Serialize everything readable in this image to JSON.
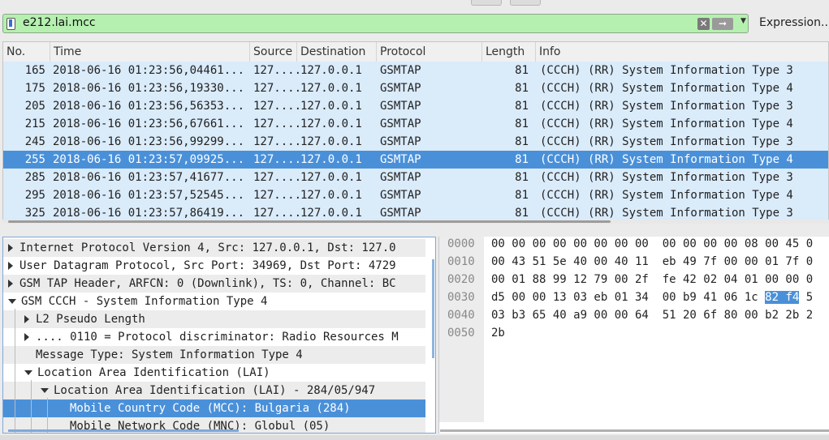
{
  "filter": {
    "value": "e212.lai.mcc",
    "clear_icon": "clear-icon",
    "apply_icon": "apply-arrow-icon",
    "dropdown_icon": "chevron-down-icon",
    "background": "#b6f0b0"
  },
  "expression_label": "Expression...",
  "packet_list": {
    "columns": [
      "No.",
      "Time",
      "Source",
      "Destination",
      "Protocol",
      "Length",
      "Info"
    ],
    "rows": [
      {
        "no": "165",
        "time": "2018-06-16 01:23:56,04461...",
        "source": "127....",
        "destination": "127.0.0.1",
        "protocol": "GSMTAP",
        "length": "81",
        "info": "(CCCH) (RR) System Information Type 3"
      },
      {
        "no": "175",
        "time": "2018-06-16 01:23:56,19330...",
        "source": "127....",
        "destination": "127.0.0.1",
        "protocol": "GSMTAP",
        "length": "81",
        "info": "(CCCH) (RR) System Information Type 4"
      },
      {
        "no": "205",
        "time": "2018-06-16 01:23:56,56353...",
        "source": "127....",
        "destination": "127.0.0.1",
        "protocol": "GSMTAP",
        "length": "81",
        "info": "(CCCH) (RR) System Information Type 3"
      },
      {
        "no": "215",
        "time": "2018-06-16 01:23:56,67661...",
        "source": "127....",
        "destination": "127.0.0.1",
        "protocol": "GSMTAP",
        "length": "81",
        "info": "(CCCH) (RR) System Information Type 4"
      },
      {
        "no": "245",
        "time": "2018-06-16 01:23:56,99299...",
        "source": "127....",
        "destination": "127.0.0.1",
        "protocol": "GSMTAP",
        "length": "81",
        "info": "(CCCH) (RR) System Information Type 3"
      },
      {
        "no": "255",
        "time": "2018-06-16 01:23:57,09925...",
        "source": "127....",
        "destination": "127.0.0.1",
        "protocol": "GSMTAP",
        "length": "81",
        "info": "(CCCH) (RR) System Information Type 4"
      },
      {
        "no": "285",
        "time": "2018-06-16 01:23:57,41677...",
        "source": "127....",
        "destination": "127.0.0.1",
        "protocol": "GSMTAP",
        "length": "81",
        "info": "(CCCH) (RR) System Information Type 3"
      },
      {
        "no": "295",
        "time": "2018-06-16 01:23:57,52545...",
        "source": "127....",
        "destination": "127.0.0.1",
        "protocol": "GSMTAP",
        "length": "81",
        "info": "(CCCH) (RR) System Information Type 4"
      },
      {
        "no": "325",
        "time": "2018-06-16 01:23:57,86419...",
        "source": "127....",
        "destination": "127.0.0.1",
        "protocol": "GSMTAP",
        "length": "81",
        "info": "(CCCH) (RR) System Information Type 3"
      }
    ],
    "selected_index": 5,
    "row_color": "#daebfa",
    "selected_color": "#4a90d9"
  },
  "details": {
    "nodes": [
      {
        "text": "Internet Protocol Version 4, Src: 127.0.0.1, Dst: 127.0",
        "state": "collapsed",
        "depth": 0
      },
      {
        "text": "User Datagram Protocol, Src Port: 34969, Dst Port: 4729",
        "state": "collapsed",
        "depth": 0
      },
      {
        "text": "GSM TAP Header, ARFCN: 0 (Downlink), TS: 0, Channel: BC",
        "state": "collapsed",
        "depth": 0
      },
      {
        "text": "GSM CCCH - System Information Type 4",
        "state": "expanded",
        "depth": 0
      },
      {
        "text": "L2 Pseudo Length",
        "state": "collapsed",
        "depth": 1
      },
      {
        "text": ".... 0110 = Protocol discriminator: Radio Resources M",
        "state": "collapsed",
        "depth": 1
      },
      {
        "text": "Message Type: System Information Type 4",
        "state": "leaf",
        "depth": 1
      },
      {
        "text": "Location Area Identification (LAI)",
        "state": "expanded",
        "depth": 1
      },
      {
        "text": "Location Area Identification (LAI) - 284/05/947",
        "state": "expanded",
        "depth": 2
      },
      {
        "text": "Mobile Country Code (MCC): Bulgaria (284)",
        "state": "leaf",
        "depth": 3
      },
      {
        "text": "Mobile Network Code (MNC): Globul (05)",
        "state": "leaf",
        "depth": 3
      }
    ],
    "selected_index": 9
  },
  "bytes": {
    "rows": [
      {
        "offset": "0000",
        "hex": "00 00 00 00 00 00 00 00  00 00 00 00 08 00 45 0"
      },
      {
        "offset": "0010",
        "hex": "00 43 51 5e 40 00 40 11  eb 49 7f 00 00 01 7f 0"
      },
      {
        "offset": "0020",
        "hex": "00 01 88 99 12 79 00 2f  fe 42 02 04 01 00 00 0"
      },
      {
        "offset": "0030",
        "hex_pre": "d5 00 00 13 03 eb 01 34  00 b9 41 06 1c ",
        "hex_hl": "82 f4",
        "hex_post": " 5"
      },
      {
        "offset": "0040",
        "hex": "03 b3 65 40 a9 00 00 64  51 20 6f 80 00 b2 2b 2"
      },
      {
        "offset": "0050",
        "hex": "2b"
      }
    ],
    "highlight_color": "#4a90d9"
  }
}
